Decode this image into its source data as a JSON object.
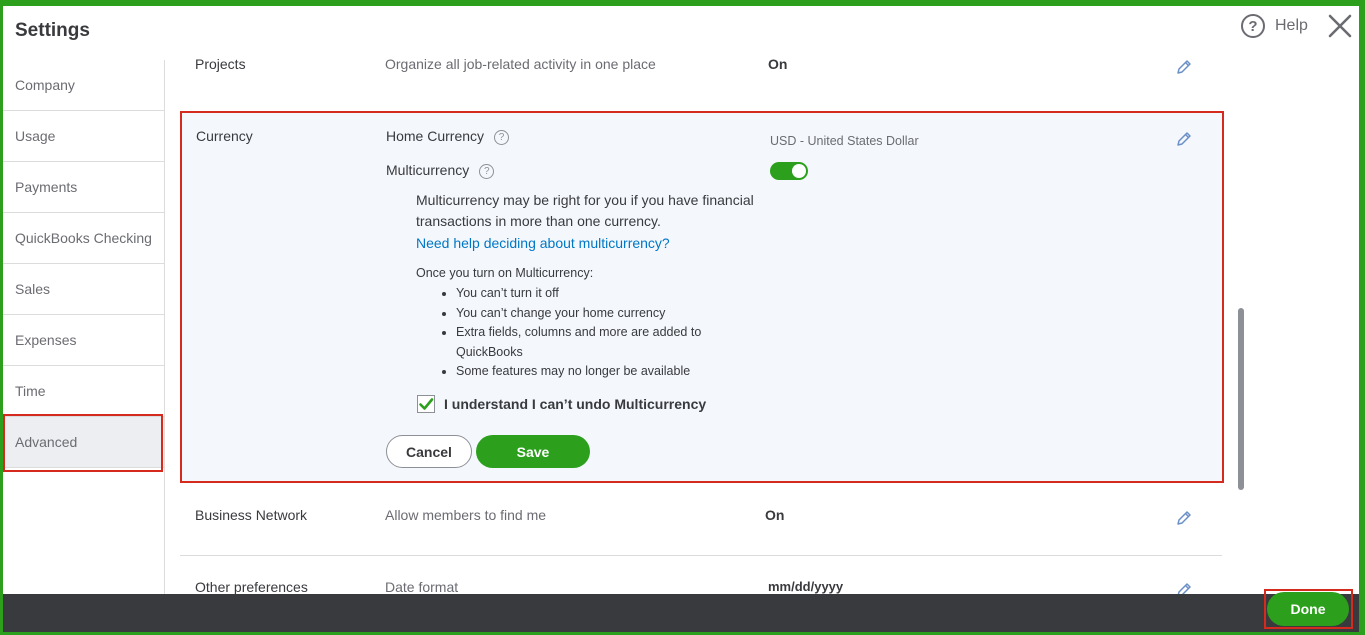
{
  "header": {
    "title": "Settings",
    "help_icon_glyph": "?",
    "help_label": "Help",
    "close_icon": "close-icon"
  },
  "sidebar": {
    "items": [
      {
        "label": "Company"
      },
      {
        "label": "Usage"
      },
      {
        "label": "Payments"
      },
      {
        "label": "QuickBooks Checking"
      },
      {
        "label": "Sales"
      },
      {
        "label": "Expenses"
      },
      {
        "label": "Time"
      },
      {
        "label": "Advanced"
      }
    ],
    "active": "Advanced"
  },
  "projects": {
    "label": "Projects",
    "description": "Organize all job-related activity in one place",
    "value": "On"
  },
  "currency": {
    "label": "Currency",
    "home_currency_label": "Home Currency",
    "home_currency_value": "USD - United States Dollar",
    "multicurrency_label": "Multicurrency",
    "multicurrency_on": true,
    "info_line1": "Multicurrency may be right for you if you have financial",
    "info_line2": "transactions in more than one currency.",
    "help_link": "Need help deciding about multicurrency?",
    "once_title": "Once you turn on Multicurrency:",
    "bullets": [
      "You can’t turn it off",
      "You can’t change your home currency",
      "Extra fields, columns and more are added to",
      "QuickBooks",
      "Some features may no longer be available"
    ],
    "confirm_label": "I understand I can’t undo Multicurrency",
    "confirm_checked": true,
    "cancel_label": "Cancel",
    "save_label": "Save"
  },
  "business_network": {
    "label": "Business Network",
    "description": "Allow members to find me",
    "value": "On"
  },
  "other_preferences": {
    "label": "Other preferences",
    "description": "Date format",
    "value": "mm/dd/yyyy"
  },
  "footer": {
    "done_label": "Done"
  },
  "colors": {
    "accent": "#2ca01c",
    "highlight": "#d52b1e",
    "link": "#0077c5",
    "footer": "#393a3d"
  }
}
